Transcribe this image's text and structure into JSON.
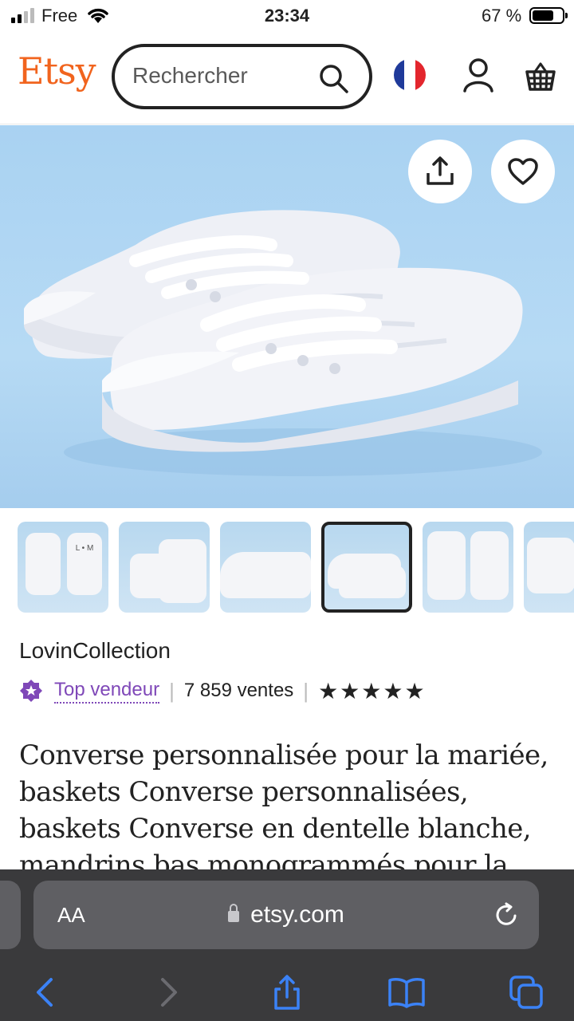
{
  "status_bar": {
    "carrier": "Free",
    "time": "23:34",
    "battery": "67 %"
  },
  "header": {
    "logo": "Etsy",
    "search_placeholder": "Rechercher"
  },
  "gallery": {
    "thumbnail_count": 6,
    "selected_index": 3,
    "thumb_engravings": [
      "L • M"
    ]
  },
  "shop": {
    "name": "LovinCollection",
    "badge": "Top vendeur",
    "sales": "7 859 ventes",
    "stars": "★★★★★",
    "rating_stars": 5
  },
  "product": {
    "title": "Converse personnalisée pour la mariée, baskets Converse personnalisées, baskets Converse en dentelle blanche, mandrins bas monogrammés pour la"
  },
  "browser": {
    "text_size_label": "AA",
    "url": "etsy.com"
  },
  "colors": {
    "etsy_orange": "#f1641e",
    "top_seller_purple": "#7f48b8",
    "safari_bar": "#3a3a3c",
    "safari_accent": "#3b82f6"
  }
}
